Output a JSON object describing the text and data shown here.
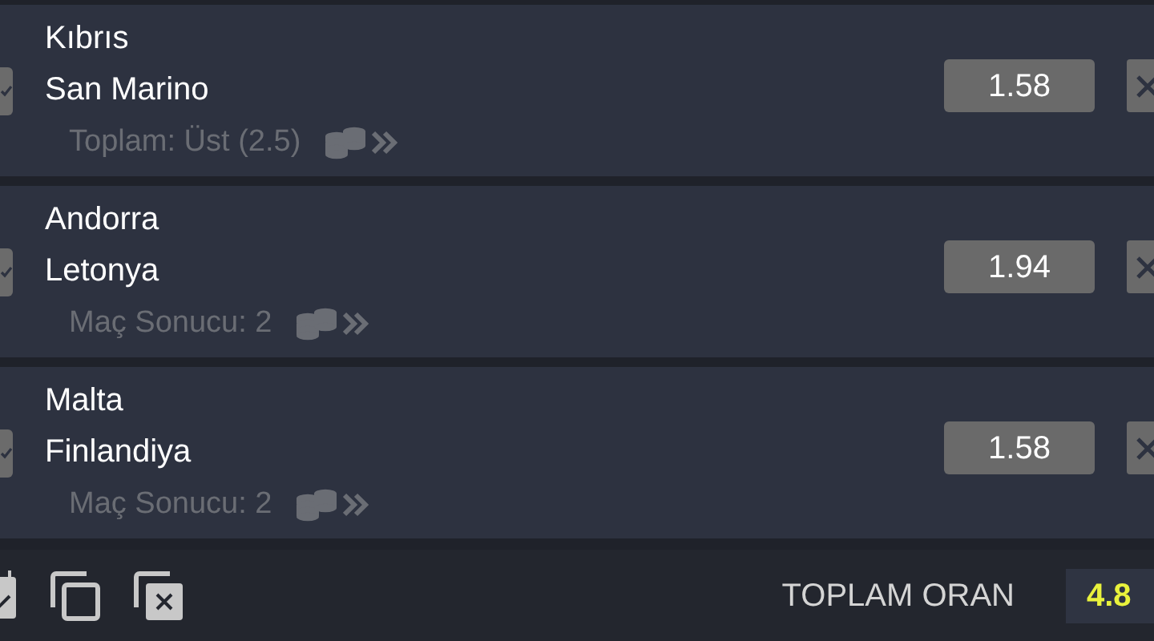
{
  "bets": [
    {
      "home": "Kıbrıs",
      "away": "San Marino",
      "market": "Toplam: Üst (2.5)",
      "odds": "1.58",
      "checked": true
    },
    {
      "home": "Andorra",
      "away": "Letonya",
      "market": "Maç Sonucu: 2",
      "odds": "1.94",
      "checked": true
    },
    {
      "home": "Malta",
      "away": "Finlandiya",
      "market": "Maç Sonucu: 2",
      "odds": "1.58",
      "checked": true
    }
  ],
  "footer": {
    "total_label": "TOPLAM ORAN",
    "total_value": "4.8"
  }
}
